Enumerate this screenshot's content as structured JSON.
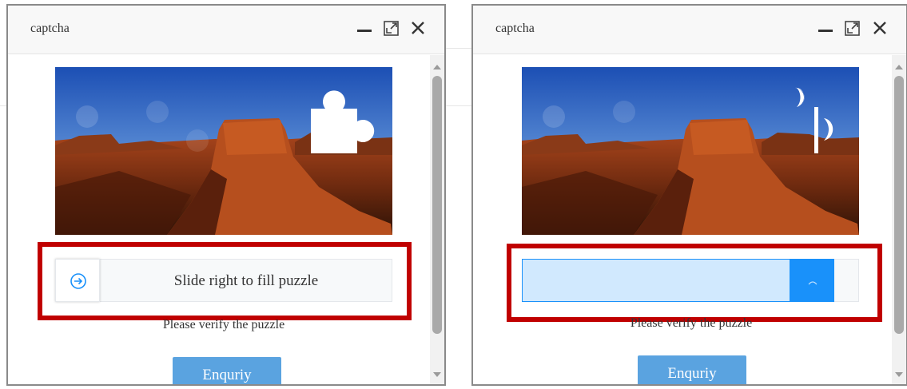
{
  "left_dialog": {
    "title": "captcha",
    "slider_label": "Slide right to fill puzzle",
    "verify_text": "Please verify the puzzle",
    "button_label": "Enquriy",
    "slider_state": "idle",
    "slider_progress": 0
  },
  "right_dialog": {
    "title": "captcha",
    "slider_label": "",
    "verify_text": "Please verify the puzzle",
    "button_label": "Enquriy",
    "slider_state": "dragging",
    "slider_progress": 0.79
  },
  "icons": {
    "minimize": "minimize-icon",
    "maximize": "maximize-icon",
    "close": "close-icon",
    "slider_handle": "arrow-right-circle-icon",
    "scroll_up": "scroll-up-arrow-icon",
    "scroll_down": "scroll-down-arrow-icon"
  },
  "colors": {
    "highlight": "#c00000",
    "slider_accent": "#1991fa",
    "slider_fill": "#d1e9fe",
    "button": "#5aa3e0"
  }
}
